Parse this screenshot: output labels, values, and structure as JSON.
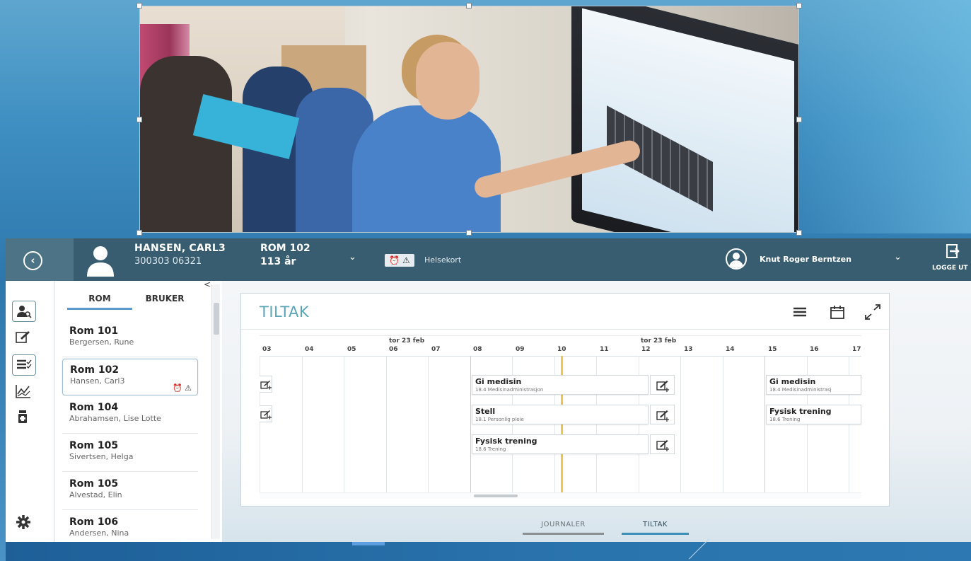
{
  "topbar": {
    "patient_name": "HANSEN, CARL3",
    "patient_id": "300303 06321",
    "room": "ROM 102",
    "age": "113 år",
    "alert_badge": "⏰ ⚠",
    "helsekort": "Helsekort",
    "user_name": "Knut Roger Berntzen",
    "logout": "LOGGE UT"
  },
  "list_panel": {
    "tabs": [
      "ROM",
      "BRUKER"
    ],
    "collapse": "<",
    "rooms": [
      {
        "room": "Rom 101",
        "name": "Bergersen, Rune"
      },
      {
        "room": "Rom 102",
        "name": "Hansen, Carl3",
        "icons": "⏰ ⚠"
      },
      {
        "room": "Rom 104",
        "name": "Abrahamsen, Lise Lotte"
      },
      {
        "room": "Rom 105",
        "name": "Sivertsen, Helga"
      },
      {
        "room": "Rom 105",
        "name": "Alvestad, Elin"
      },
      {
        "room": "Rom 106",
        "name": "Andersen, Nina"
      }
    ]
  },
  "card": {
    "title": "TILTAK",
    "day_labels": [
      "tor 23 feb",
      "tor 23 feb"
    ],
    "hours": [
      "03",
      "04",
      "05",
      "06",
      "07",
      "08",
      "09",
      "10",
      "11",
      "12",
      "13",
      "14",
      "15",
      "16",
      "17"
    ],
    "tasks": [
      {
        "title": "Gi medisin",
        "sub": "18.4 Medisinadministrasjon"
      },
      {
        "title": "Stell",
        "sub": "18.1 Personlig pleie"
      },
      {
        "title": "Fysisk trening",
        "sub": "18.6 Trening"
      },
      {
        "title": "Gi medisin",
        "sub": "18.4 Medisinadministrasj"
      },
      {
        "title": "Fysisk trening",
        "sub": "18.6 Trening"
      }
    ]
  },
  "bottom_tabs": [
    "JOURNALER",
    "TILTAK"
  ],
  "colors": {
    "topbar": "#385d71",
    "accent": "#5aa5b7",
    "now_line": "#f2c44d",
    "background": "#3f8fc2"
  }
}
